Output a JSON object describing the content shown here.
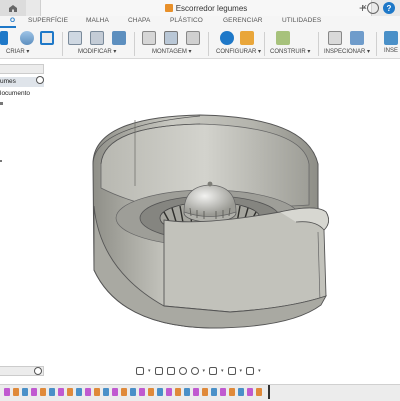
{
  "window": {
    "document_title": "Escorredor legumes",
    "close_glyph": "×",
    "new_tab_glyph": "+",
    "help_glyph": "?"
  },
  "tabs": [
    {
      "label": "O",
      "active": true
    },
    {
      "label": "SUPERFÍCIE"
    },
    {
      "label": "MALHA"
    },
    {
      "label": "CHAPA"
    },
    {
      "label": "PLÁSTICO"
    },
    {
      "label": "GERENCIAR"
    },
    {
      "label": "UTILIDADES"
    }
  ],
  "toolbar": {
    "groups": [
      {
        "label": "CRIAR ▾"
      },
      {
        "label": "MODIFICAR ▾"
      },
      {
        "label": "MONTAGEM ▾"
      },
      {
        "label": "CONFIGURAR ▾"
      },
      {
        "label": "CONSTRUIR ▾"
      },
      {
        "label": "INSPECIONAR ▾"
      },
      {
        "label": "INSE"
      }
    ]
  },
  "browser": {
    "title": "umes",
    "items": [
      "locumento"
    ]
  },
  "colors": {
    "accent": "#1e78c8",
    "doc_icon": "#e8902a",
    "model_body": "#b8b8b0"
  }
}
